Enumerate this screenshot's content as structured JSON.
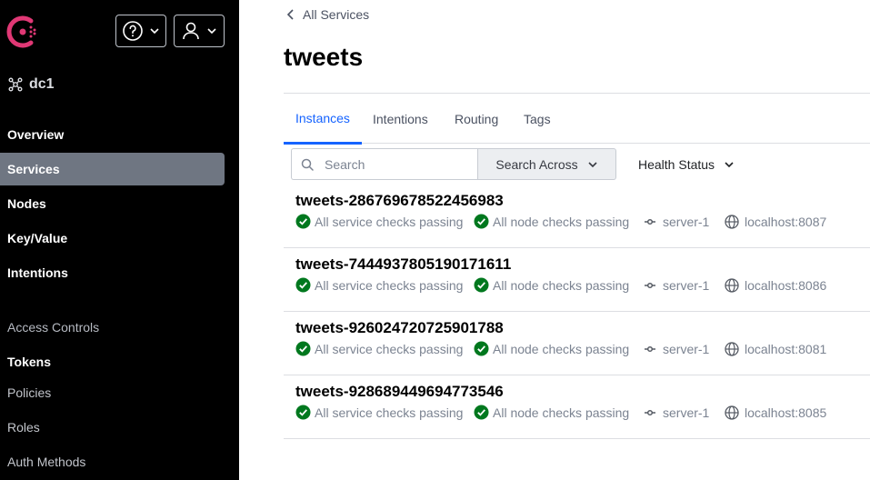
{
  "header": {
    "help_label": "?",
    "user_label": ""
  },
  "datacenter": {
    "name": "dc1"
  },
  "nav": {
    "overview": "Overview",
    "services": "Services",
    "nodes": "Nodes",
    "keyvalue": "Key/Value",
    "intentions": "Intentions",
    "access_controls": "Access Controls",
    "tokens": "Tokens",
    "policies": "Policies",
    "roles": "Roles",
    "auth_methods": "Auth Methods"
  },
  "breadcrumb": {
    "label": "All Services"
  },
  "page": {
    "title": "tweets"
  },
  "tabs": [
    "Instances",
    "Intentions",
    "Routing",
    "Tags"
  ],
  "search": {
    "placeholder": "Search",
    "value": ""
  },
  "filters": {
    "search_across": "Search Across",
    "health_status": "Health Status"
  },
  "colors": {
    "accent": "#1563ff",
    "pass": "#00781e",
    "brand": "#e03875",
    "active_nav": "#6f7682"
  },
  "instances": [
    {
      "name": "tweets-286769678522456983",
      "service_checks": "All service checks passing",
      "node_checks": "All node checks passing",
      "node": "server-1",
      "address": "localhost:8087"
    },
    {
      "name": "tweets-7444937805190171611",
      "service_checks": "All service checks passing",
      "node_checks": "All node checks passing",
      "node": "server-1",
      "address": "localhost:8086"
    },
    {
      "name": "tweets-926024720725901788",
      "service_checks": "All service checks passing",
      "node_checks": "All node checks passing",
      "node": "server-1",
      "address": "localhost:8081"
    },
    {
      "name": "tweets-928689449694773546",
      "service_checks": "All service checks passing",
      "node_checks": "All node checks passing",
      "node": "server-1",
      "address": "localhost:8085"
    }
  ]
}
